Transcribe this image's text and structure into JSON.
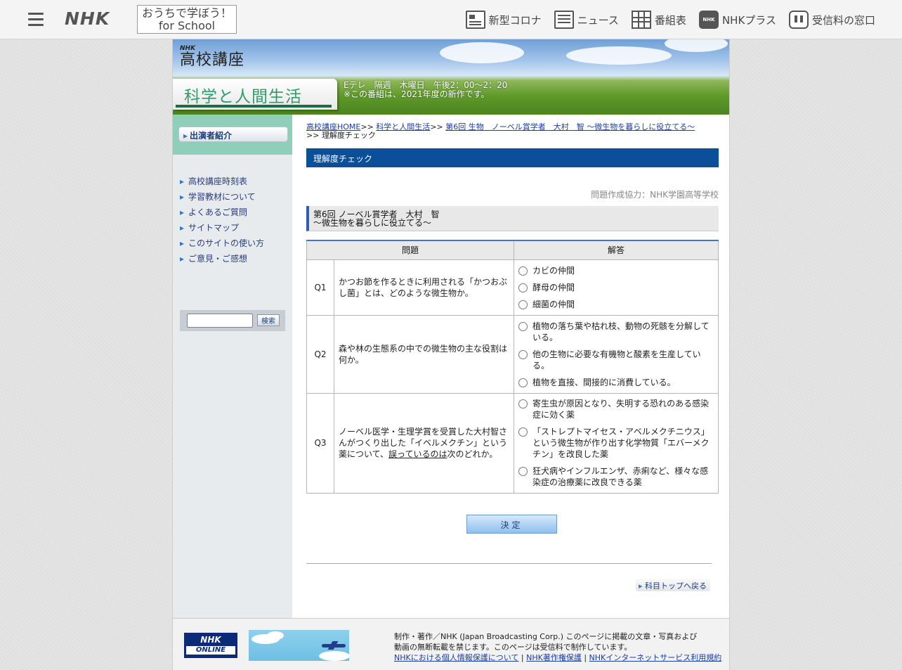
{
  "topbar": {
    "logo": "NHK",
    "school_line1": "おうちで学ぼう！",
    "school_line2": "for School",
    "nav": [
      {
        "label": "新型コロナ",
        "icon": "corona-info-icon"
      },
      {
        "label": "ニュース",
        "icon": "news-icon"
      },
      {
        "label": "番組表",
        "icon": "program-guide-icon"
      },
      {
        "label": "NHKプラス",
        "icon": "nhk-plus-icon"
      },
      {
        "label": "受信料の窓口",
        "icon": "receiving-fee-icon"
      }
    ]
  },
  "header": {
    "logo_small": "NHK",
    "logo_main": "高校講座",
    "title": "科学と人間生活",
    "air_line1": "Eテレ　隔週　木曜日　午後2：00〜2：20",
    "air_line2": "※この番組は、2021年度の新作です。"
  },
  "sidebar": {
    "cast_button": "出演者紹介",
    "menu": [
      "高校講座時刻表",
      "学習教材について",
      "よくあるご質問",
      "サイトマップ",
      "このサイトの使い方",
      "ご意見・ご感想"
    ],
    "search_button": "検索"
  },
  "breadcrumb": {
    "home": "高校講座HOME",
    "sep": ">>",
    "subject": "科学と人間生活",
    "episode": "第6回 生物　ノーベル賞学者　大村　智 〜微生物を暮らしに役立てる〜",
    "current_prefix": ">>",
    "current": "理解度チェック"
  },
  "section_title": "理解度チェック",
  "credit": "問題作成協力：NHK学園高等学校",
  "episode_title": {
    "line1": "第6回 ノーベル賞学者　大村　智",
    "line2": "〜微生物を暮らしに役立てる〜"
  },
  "quiz": {
    "col_question": "問題",
    "col_answer": "解答",
    "questions": [
      {
        "no": "Q1",
        "text": "かつお節を作るときに利用される「かつおぶし菌」とは、どのような微生物か。",
        "options": [
          "カビの仲間",
          "酵母の仲間",
          "細菌の仲間"
        ]
      },
      {
        "no": "Q2",
        "text": "森や林の生態系の中での微生物の主な役割は何か。",
        "options": [
          "植物の落ち葉や枯れ枝、動物の死骸を分解している。",
          "他の生物に必要な有機物と酸素を生産している。",
          "植物を直接、間接的に消費している。"
        ]
      },
      {
        "no": "Q3",
        "text_before": "ノーベル医学・生理学賞を受賞した大村智さんがつくり出した「イベルメクチン」という薬について、",
        "text_underline": "誤っているのは",
        "text_after": "次のどれか。",
        "options": [
          "寄生虫が原因となり、失明する恐れのある感染症に効く薬",
          "「ストレプトマイセス・アベルメクチニウス」という微生物が作り出す化学物質「エバーメクチン」を改良した薬",
          "狂犬病やインフルエンザ、赤痢など、様々な感染症の治療薬に改良できる薬"
        ]
      }
    ],
    "submit": "決定"
  },
  "back_button": "科目トップへ戻る",
  "footer": {
    "online_logo_top": "NHK",
    "online_logo_bottom": "ONLINE",
    "copyright_line1": "制作・著作／NHK (Japan Broadcasting Corp.) このページに掲載の文章・写真および",
    "copyright_line2": "動画の無断転載を禁じます。このページは受信料で制作しています。",
    "links": [
      "NHKにおける個人情報保護について",
      "NHK著作権保護",
      "NHKインターネットサービス利用規約"
    ],
    "link_sep": "|"
  }
}
